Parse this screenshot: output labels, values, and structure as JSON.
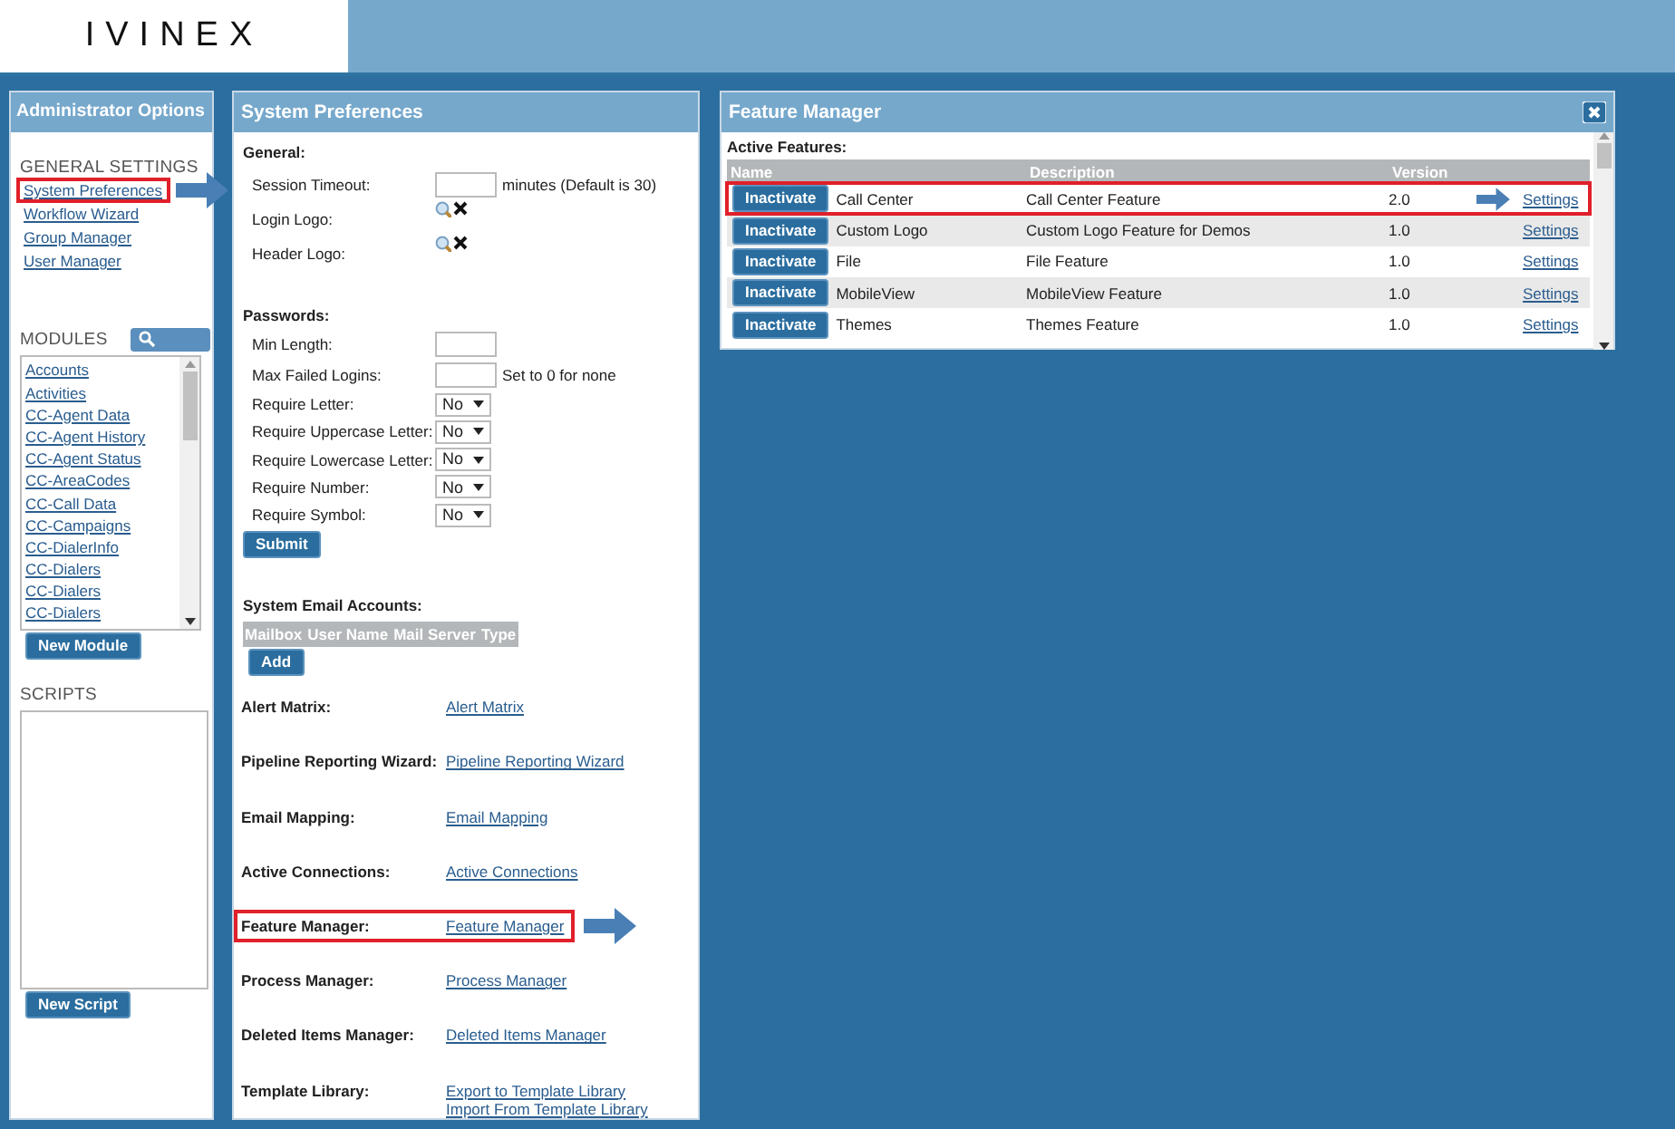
{
  "header": {
    "logo": "IVINEX"
  },
  "admin_panel": {
    "title": "Administrator Options",
    "general_settings": {
      "heading": "GENERAL SETTINGS",
      "items": [
        {
          "label": "System Preferences",
          "highlighted": true
        },
        {
          "label": "Workflow Wizard",
          "highlighted": false
        },
        {
          "label": "Group Manager",
          "highlighted": false
        },
        {
          "label": "User Manager",
          "highlighted": false
        }
      ]
    },
    "modules": {
      "heading": "MODULES",
      "items": [
        "Accounts",
        "Activities",
        "CC-Agent Data",
        "CC-Agent History",
        "CC-Agent Status",
        "CC-AreaCodes",
        "CC-Call Data",
        "CC-Campaigns",
        "CC-DialerInfo",
        "CC-Dialers",
        "CC-Dialers",
        "CC-Dialers"
      ],
      "button": "New Module"
    },
    "scripts": {
      "heading": "SCRIPTS",
      "button": "New Script"
    }
  },
  "preferences_panel": {
    "title": "System Preferences",
    "general": {
      "heading": "General:",
      "fields": [
        {
          "kind": "input",
          "label": "Session Timeout:",
          "note": "minutes (Default is 30)"
        },
        {
          "kind": "image",
          "label": "Login Logo:"
        },
        {
          "kind": "image",
          "label": "Header Logo:"
        }
      ]
    },
    "passwords": {
      "heading": "Passwords:",
      "fields": [
        {
          "kind": "input",
          "label": "Min Length:"
        },
        {
          "kind": "input",
          "label": "Max Failed Logins:",
          "note": "Set to 0 for none"
        },
        {
          "kind": "select",
          "label": "Require Letter:",
          "value": "No"
        },
        {
          "kind": "select",
          "label": "Require Uppercase Letter:",
          "value": "No"
        },
        {
          "kind": "select",
          "label": "Require Lowercase Letter:",
          "value": "No"
        },
        {
          "kind": "select",
          "label": "Require Number:",
          "value": "No"
        },
        {
          "kind": "select",
          "label": "Require Symbol:",
          "value": "No"
        }
      ],
      "button": "Submit"
    },
    "email_accounts": {
      "heading": "System Email Accounts:",
      "columns": [
        "Mailbox",
        "User Name",
        "Mail Server",
        "Type"
      ],
      "button": "Add"
    },
    "tools": [
      {
        "label": "Alert Matrix:",
        "links": [
          "Alert Matrix"
        ],
        "highlighted": false
      },
      {
        "label": "Pipeline Reporting Wizard:",
        "links": [
          "Pipeline Reporting Wizard"
        ],
        "highlighted": false
      },
      {
        "label": "Email Mapping:",
        "links": [
          "Email Mapping"
        ],
        "highlighted": false
      },
      {
        "label": "Active Connections:",
        "links": [
          "Active Connections"
        ],
        "highlighted": false
      },
      {
        "label": "Feature Manager:",
        "links": [
          "Feature Manager"
        ],
        "highlighted": true
      },
      {
        "label": "Process Manager:",
        "links": [
          "Process Manager"
        ],
        "highlighted": false
      },
      {
        "label": "Deleted Items Manager:",
        "links": [
          "Deleted Items Manager"
        ],
        "highlighted": false
      },
      {
        "label": "Template Library:",
        "links": [
          "Export to Template Library",
          "Import From Template Library"
        ],
        "highlighted": false
      }
    ]
  },
  "feature_manager": {
    "title": "Feature Manager",
    "section": "Active Features:",
    "columns": [
      "Name",
      "Description",
      "Version"
    ],
    "rows": [
      {
        "button": "Inactivate",
        "name": "Call Center",
        "description": "Call Center Feature",
        "version": "2.0",
        "link": "Settings",
        "highlighted": true
      },
      {
        "button": "Inactivate",
        "name": "Custom Logo",
        "description": "Custom Logo Feature for Demos",
        "version": "1.0",
        "link": "Settings",
        "highlighted": false
      },
      {
        "button": "Inactivate",
        "name": "File",
        "description": "File Feature",
        "version": "1.0",
        "link": "Settings",
        "highlighted": false
      },
      {
        "button": "Inactivate",
        "name": "MobileView",
        "description": "MobileView Feature",
        "version": "1.0",
        "link": "Settings",
        "highlighted": false
      },
      {
        "button": "Inactivate",
        "name": "Themes",
        "description": "Themes Feature",
        "version": "1.0",
        "link": "Settings",
        "highlighted": false
      }
    ]
  }
}
